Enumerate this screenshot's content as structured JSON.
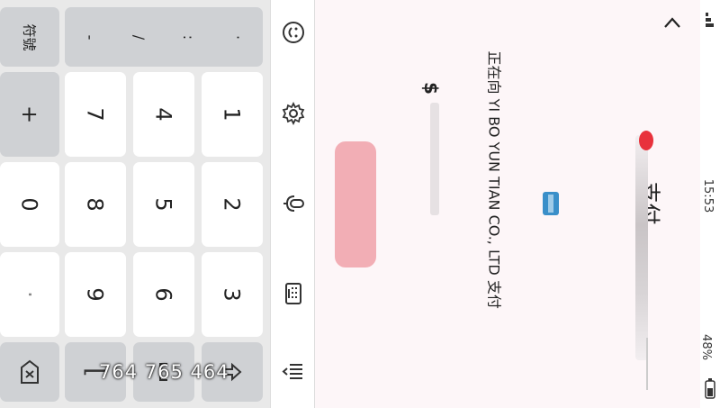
{
  "keyboard": {
    "symbols_key": "符號",
    "punct": [
      "-",
      "/",
      ":",
      "·"
    ],
    "digits": {
      "k1": "1",
      "k2": "2",
      "k3": "3",
      "k4": "4",
      "k5": "5",
      "k6": "6",
      "k7": "7",
      "k8": "8",
      "k9": "9",
      "k0": "0"
    },
    "plus": "+",
    "dot": "·"
  },
  "overlay_number": "764 765 464",
  "payment": {
    "title": "支付",
    "payee_line": "正在向 YI BO YUN TIAN CO., LTD 支付",
    "currency": "$"
  },
  "status_bar": {
    "time": "15:53",
    "battery": "48%"
  },
  "colors": {
    "accent_red": "#e8323c",
    "confirm_pink": "#f2aeb5"
  }
}
